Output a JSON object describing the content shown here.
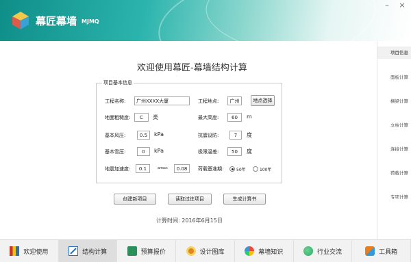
{
  "header": {
    "app_name": "幕匠幕墙",
    "app_code": "MJMQ",
    "window_buttons": [
      "–",
      "×"
    ]
  },
  "main": {
    "title": "欢迎使用幕匠-幕墙结构计算",
    "group_title": "项目基本信息",
    "fields": {
      "project_name": {
        "label": "工程名称:",
        "value": "广州XXXX大厦"
      },
      "project_location": {
        "label": "工程地点:",
        "value": "广州"
      },
      "location_button": "地点选择",
      "roughness": {
        "label": "地面粗糙度:",
        "value": "C",
        "unit": "类"
      },
      "max_height": {
        "label": "最大高度:",
        "value": "60",
        "unit": "m"
      },
      "wind_pressure": {
        "label": "基本风压:",
        "value": "0.5",
        "unit": "kPa"
      },
      "seismic_intensity": {
        "label": "抗震设防:",
        "value": "7",
        "unit": "度"
      },
      "snow_pressure": {
        "label": "基本雪压:",
        "value": "0",
        "unit": "kPa"
      },
      "temp_diff": {
        "label": "极限温差:",
        "value": "50",
        "unit": "度"
      },
      "seismic_accel": {
        "label": "地震加速度:",
        "value": "0.1"
      },
      "alpha_max": {
        "label": "amax:",
        "value": "0.08"
      },
      "design_period": {
        "label": "荷载基准期:",
        "options": [
          "50年",
          "100年"
        ],
        "selected": "50年"
      }
    },
    "buttons": {
      "new_project": "创建新项目",
      "load_project": "读取过往项目",
      "generate_report": "生成计算书"
    },
    "calc_time": "计算时间: 2016年6月15日"
  },
  "right_nav": [
    "项目信息",
    "面板计算",
    "横梁计算",
    "立柱计算",
    "连接计算",
    "荷载计算",
    "专项计算"
  ],
  "right_nav_active": "项目信息",
  "bottom_tabs": [
    {
      "label": "欢迎使用",
      "icon": "welcome-icon",
      "color": "#c0392b"
    },
    {
      "label": "结构计算",
      "icon": "calc-icon",
      "color": "#2c6fb7"
    },
    {
      "label": "预算报价",
      "icon": "budget-icon",
      "color": "#2c8f5a"
    },
    {
      "label": "设计图库",
      "icon": "gallery-icon",
      "color": "#e08a1e"
    },
    {
      "label": "幕墙知识",
      "icon": "knowledge-icon",
      "color": "#8e44ad"
    },
    {
      "label": "行业交流",
      "icon": "exchange-icon",
      "color": "#27ae60"
    },
    {
      "label": "工具箱",
      "icon": "toolbox-icon",
      "color": "#e67e22"
    }
  ],
  "bottom_active": "结构计算"
}
